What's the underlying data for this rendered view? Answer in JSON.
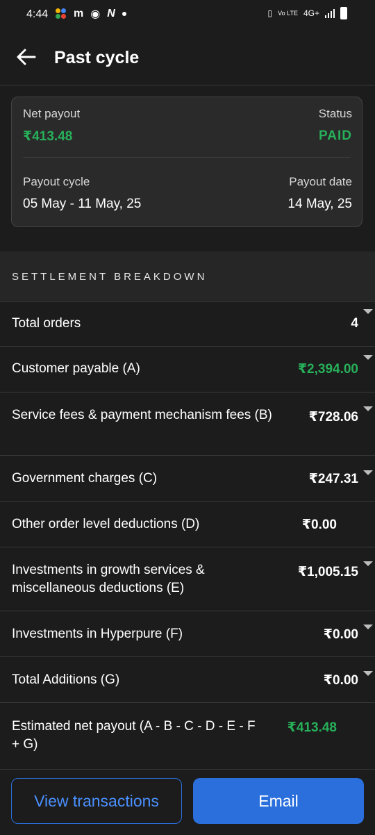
{
  "status_bar": {
    "time": "4:44",
    "network": "4G+",
    "volte": "Vo LTE"
  },
  "header": {
    "title": "Past cycle"
  },
  "summary": {
    "net_payout_label": "Net payout",
    "net_payout_value": "₹413.48",
    "status_label": "Status",
    "status_value": "PAID",
    "cycle_label": "Payout cycle",
    "cycle_value": "05 May - 11 May, 25",
    "date_label": "Payout date",
    "date_value": "14 May, 25"
  },
  "section": {
    "title": "SETTLEMENT BREAKDOWN"
  },
  "rows": [
    {
      "label": "Total orders",
      "value": "4"
    },
    {
      "label": "Customer payable (A)",
      "value": "₹2,394.00"
    },
    {
      "label": "Service fees & payment mechanism fees (B)",
      "value": "₹728.06"
    },
    {
      "label": "Government charges (C)",
      "value": "₹247.31"
    },
    {
      "label": "Other order level deductions (D)",
      "value": "₹0.00"
    },
    {
      "label": "Investments in growth services & miscellaneous deductions (E)",
      "value": "₹1,005.15"
    },
    {
      "label": "Investments in Hyperpure (F)",
      "value": "₹0.00"
    },
    {
      "label": "Total Additions (G)",
      "value": "₹0.00"
    },
    {
      "label": "Estimated net payout (A - B - C - D - E - F + G)",
      "value": "₹413.48"
    }
  ],
  "buttons": {
    "view_transactions": "View transactions",
    "email": "Email"
  },
  "colors": {
    "positive": "#27b05a",
    "primary": "#2a6fdc"
  }
}
